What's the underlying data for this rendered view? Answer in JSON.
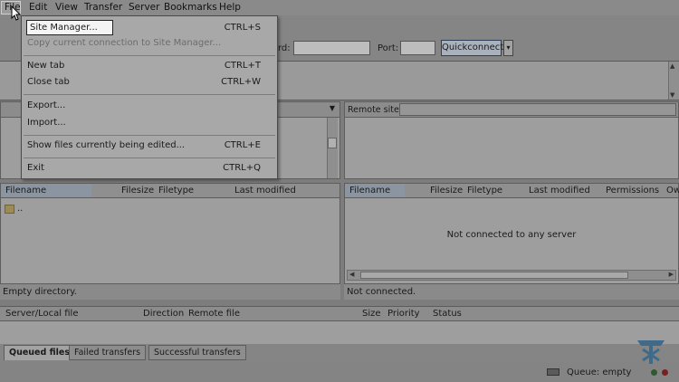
{
  "menubar": {
    "items": [
      {
        "label": "File"
      },
      {
        "label": "Edit"
      },
      {
        "label": "View"
      },
      {
        "label": "Transfer"
      },
      {
        "label": "Server"
      },
      {
        "label": "Bookmarks"
      },
      {
        "label": "Help"
      }
    ]
  },
  "file_menu": {
    "items": [
      {
        "label": "Site Manager...",
        "shortcut": "CTRL+S"
      },
      {
        "label": "Copy current connection to Site Manager...",
        "shortcut": ""
      },
      {
        "label": "New tab",
        "shortcut": "CTRL+T"
      },
      {
        "label": "Close tab",
        "shortcut": "CTRL+W"
      },
      {
        "label": "Export...",
        "shortcut": ""
      },
      {
        "label": "Import...",
        "shortcut": ""
      },
      {
        "label": "Show files currently being edited...",
        "shortcut": "CTRL+E"
      },
      {
        "label": "Exit",
        "shortcut": "CTRL+Q"
      }
    ]
  },
  "quickconnect": {
    "password_label": "rd:",
    "port_label": "Port:",
    "button_label": "Quickconnect",
    "arrow": "▾"
  },
  "local": {
    "columns": [
      "Filename",
      "Filesize",
      "Filetype",
      "Last modified"
    ],
    "rows": [
      {
        "name": ".."
      }
    ],
    "status": "Empty directory."
  },
  "remote": {
    "site_label": "Remote site:",
    "columns": [
      "Filename",
      "Filesize",
      "Filetype",
      "Last modified",
      "Permissions",
      "Ow"
    ],
    "message": "Not connected to any server",
    "status": "Not connected."
  },
  "queue": {
    "columns": [
      "Server/Local file",
      "Direction",
      "Remote file",
      "Size",
      "Priority",
      "Status"
    ],
    "tabs": [
      "Queued files",
      "Failed transfers",
      "Successful transfers"
    ],
    "status": "Queue: empty"
  },
  "colors": {
    "accent": "#2b3f57",
    "dim_overlay": "#7d7d7d",
    "red_led": "#7a2020",
    "green_led": "#2f5a2f"
  }
}
